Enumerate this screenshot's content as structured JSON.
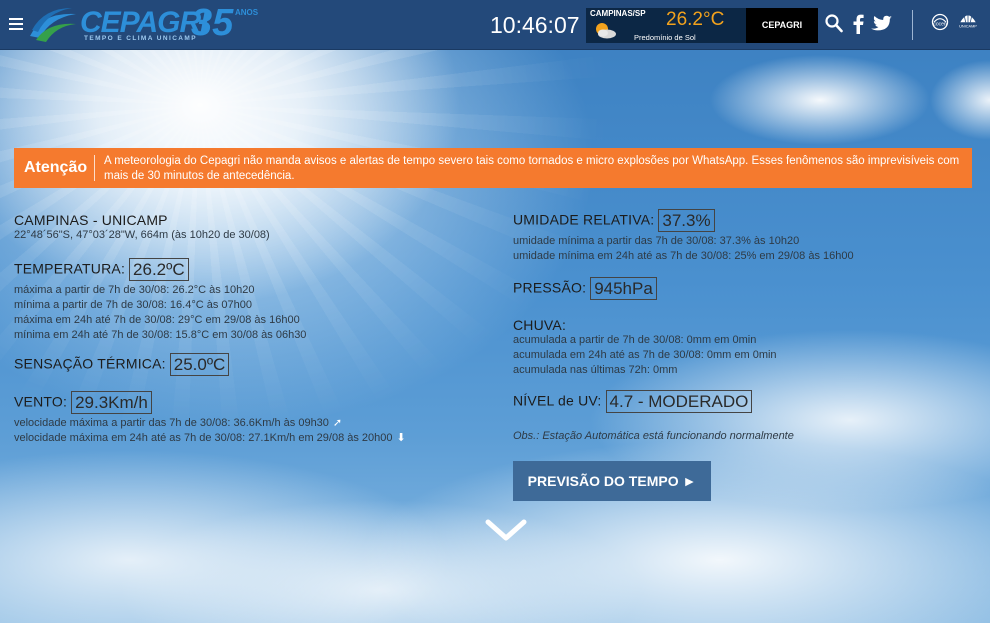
{
  "header": {
    "logo": {
      "name": "CEPAGRI",
      "sub": "TEMPO E CLIMA UNICAMP",
      "years": "35",
      "anos": "ANOS"
    },
    "clock": "10:46:07",
    "weather_widget": {
      "city": "CAMPINAS/SP",
      "temp": "26.2°C",
      "desc": "Predomínio de Sol",
      "icon": "partly-sunny-icon"
    },
    "cepagri_label": "CEPAGRI",
    "icons": [
      "search-icon",
      "facebook-icon",
      "twitter-icon",
      "cocen-logo",
      "unicamp-logo"
    ]
  },
  "alert": {
    "title": "Atenção",
    "text": "A meteorologia do Cepagri não manda avisos e alertas de tempo severo tais como tornados e micro explosões por WhatsApp. Esses fenômenos são imprevisíveis com mais de 30 minutos de antecedência.",
    "color": "#f57a2e"
  },
  "station": {
    "name": "CAMPINAS - UNICAMP",
    "coords": "22°48´56\"S, 47°03´28\"W, 664m (às 10h20 de 30/08)"
  },
  "temperatura": {
    "label": "TEMPERATURA:",
    "value": "26.2ºC",
    "lines": [
      "máxima a partir de 7h de 30/08: 26.2°C às 10h20",
      "mínima a partir de 7h de 30/08: 16.4°C às 07h00",
      "máxima em 24h até 7h de 30/08: 29°C em 29/08 às 16h00",
      "mínima em 24h até 7h de 30/08: 15.8°C em 30/08 às 06h30"
    ]
  },
  "sensacao": {
    "label": "SENSAÇÃO TÉRMICA:",
    "value": "25.0ºC"
  },
  "vento": {
    "label": "VENTO:",
    "value": "29.3Km/h",
    "lines": [
      "velocidade máxima a partir das 7h de 30/08: 36.6Km/h às 09h30",
      "velocidade máxima em 24h até as 7h de 30/08: 27.1Km/h em 29/08 às 20h00"
    ]
  },
  "umidade": {
    "label": "UMIDADE RELATIVA:",
    "value": "37.3%",
    "lines": [
      "umidade mínima a partir das 7h de 30/08: 37.3% às 10h20",
      "umidade mínima em 24h até as 7h de 30/08: 25% em 29/08 às 16h00"
    ]
  },
  "pressao": {
    "label": "PRESSÃO:",
    "value": "945hPa"
  },
  "chuva": {
    "label": "CHUVA:",
    "lines": [
      "acumulada a partir de 7h de 30/08: 0mm em 0min",
      "acumulada em 24h até as 7h de 30/08: 0mm em 0min",
      "acumulada nas últimas 72h: 0mm"
    ]
  },
  "uv": {
    "label": "NÍVEL de UV:",
    "value": "4.7 - MODERADO"
  },
  "obs": "Obs.: Estação Automática está funcionando normalmente",
  "previsao_button": "PREVISÃO DO TEMPO ►",
  "scroll_down_icon": "chevron-down-icon"
}
